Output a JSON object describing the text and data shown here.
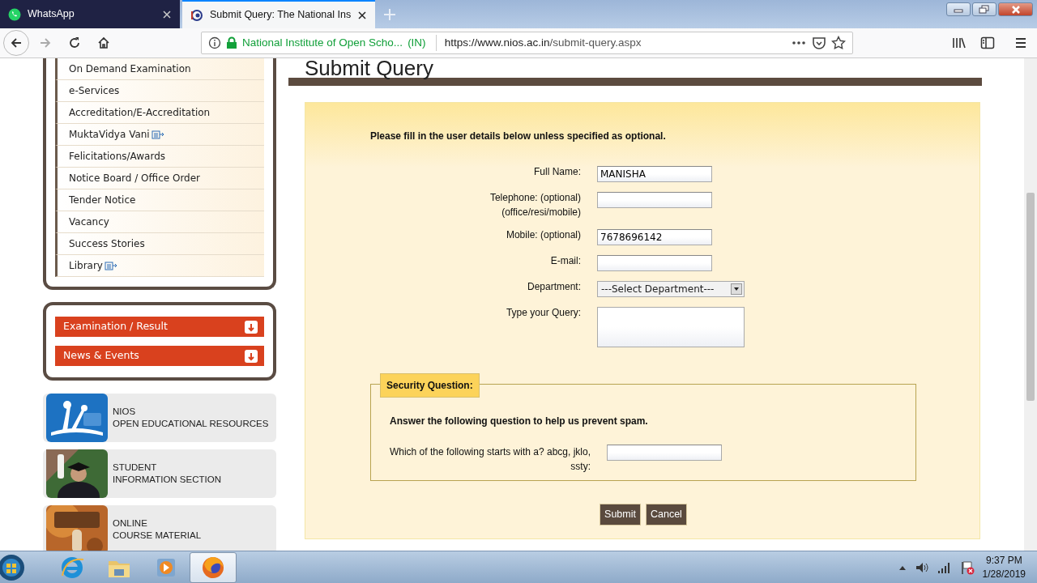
{
  "browser": {
    "tabs": [
      {
        "title": "WhatsApp",
        "selected": false,
        "kind": "whatsapp"
      },
      {
        "title": "Submit Query: The National Ins",
        "selected": true,
        "kind": "nios"
      }
    ],
    "nav_buttons": [
      {
        "kind": "back",
        "disabled": false
      },
      {
        "kind": "forward",
        "disabled": true
      },
      {
        "kind": "reload",
        "disabled": false
      },
      {
        "kind": "home",
        "disabled": false
      }
    ],
    "address": {
      "site_name": "National Institute of Open Scho...",
      "country": "(IN)",
      "url_host": "https://www.nios.ac.in",
      "url_path": "/submit-query.aspx"
    }
  },
  "sidebar": {
    "menu_items": [
      {
        "label": "On Demand Examination",
        "external": false
      },
      {
        "label": "e-Services",
        "external": false
      },
      {
        "label": "Accreditation/E-Accreditation",
        "external": false
      },
      {
        "label": "MuktaVidya Vani",
        "external": true
      },
      {
        "label": "Felicitations/Awards",
        "external": false
      },
      {
        "label": "Notice Board / Office Order",
        "external": false
      },
      {
        "label": "Tender Notice",
        "external": false
      },
      {
        "label": "Vacancy",
        "external": false
      },
      {
        "label": "Success Stories",
        "external": false
      },
      {
        "label": "Library",
        "external": true
      }
    ],
    "accordion": [
      {
        "label": "Examination / Result",
        "expanded": false
      },
      {
        "label": "News & Events",
        "expanded": false
      }
    ],
    "resource_cards": [
      {
        "lines": [
          "NIOS",
          "OPEN EDUCATIONAL RESOURCES"
        ]
      },
      {
        "lines": [
          "STUDENT",
          "INFORMATION SECTION"
        ]
      },
      {
        "lines": [
          "ONLINE",
          "COURSE MATERIAL"
        ]
      }
    ]
  },
  "page": {
    "title": "Submit Query",
    "form": {
      "intro": "Please fill in the user details below unless specified as optional.",
      "fields": [
        {
          "label": [
            "Full Name:"
          ],
          "kind": "text",
          "value": "MANISHA"
        },
        {
          "label": [
            "Telephone: (optional)",
            "(office/resi/mobile)"
          ],
          "kind": "text"
        },
        {
          "label": [
            "Mobile: (optional)"
          ],
          "kind": "text",
          "value": "7678696142"
        },
        {
          "label": [
            "E-mail:"
          ],
          "kind": "text"
        },
        {
          "label": [
            "Department:"
          ],
          "kind": "select",
          "value": "---Select Department---"
        },
        {
          "label": [
            "Type your Query:"
          ],
          "kind": "textarea"
        }
      ],
      "security": {
        "legend": "Security Question:",
        "instruction": "Answer the following question to help us prevent spam.",
        "question": "Which of the following starts with a? abcg, jklo, ssty:"
      },
      "buttons": [
        "Submit",
        "Cancel"
      ]
    }
  },
  "taskbar": {
    "apps": [
      {
        "kind": "ie",
        "active": false
      },
      {
        "kind": "folder",
        "active": false
      },
      {
        "kind": "media",
        "active": false
      },
      {
        "kind": "firefox",
        "active": true
      }
    ],
    "time": "9:37 PM",
    "date": "1/28/2019"
  }
}
